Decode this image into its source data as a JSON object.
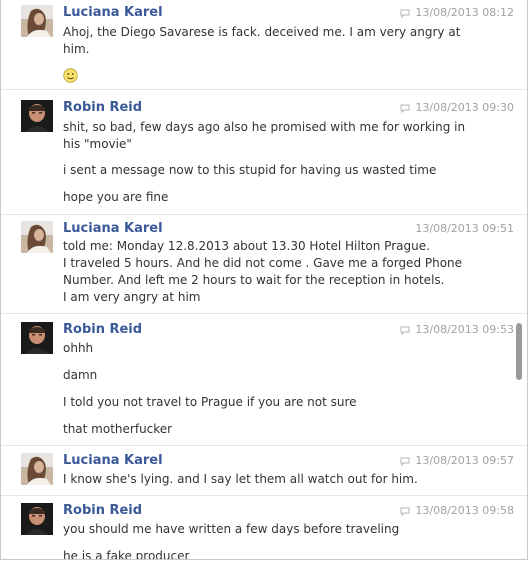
{
  "messages": [
    {
      "author": "Luciana Karel",
      "time": "13/08/2013 08:12",
      "lines": [
        "Ahoj, the Diego Savarese is fack. deceived me. I am very angry at",
        "him."
      ]
    },
    {
      "author": "Robin Reid",
      "time": "13/08/2013 09:30",
      "lines": [
        "shit, so bad, few days ago also he promised with me for working in",
        "his \"movie\"",
        "i sent a message now to this stupid for having us wasted time",
        "hope you are fine"
      ]
    },
    {
      "author": "Luciana Karel",
      "time": "13/08/2013 09:51",
      "lines": [
        "told me:  Monday 12.8.2013 about 13.30 Hotel Hilton Prague.",
        "I traveled 5 hours. And he did not come . Gave me a forged Phone",
        "Number. And left me 2 hours to wait for the reception in hotels.",
        "I am very angry at him"
      ]
    },
    {
      "author": "Robin Reid",
      "time": "13/08/2013 09:53",
      "lines": [
        "ohhh",
        "damn",
        "I told you not travel to Prague if you are not sure",
        "that motherfucker"
      ]
    },
    {
      "author": "Luciana Karel",
      "time": "13/08/2013 09:57",
      "lines": [
        "I know she's lying. and I say let them all watch out for him."
      ]
    },
    {
      "author": "Robin Reid",
      "time": "13/08/2013 09:58",
      "lines": [
        "you should me have written a few days before traveling",
        "he is a fake producer"
      ]
    }
  ],
  "icons": {
    "comment": "comment-bubble-icon",
    "smiley": "smiley-icon"
  },
  "colors": {
    "author": "#3b5998",
    "timestamp": "#a2a2a2",
    "text": "#333333"
  }
}
